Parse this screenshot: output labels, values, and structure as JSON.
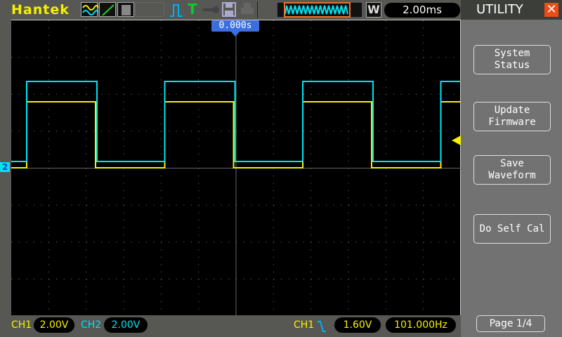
{
  "header": {
    "brand": "Hantek",
    "timebase_label": "W",
    "timebase": "2.00ms",
    "trigger_time": "0.000s"
  },
  "menu": {
    "title": "UTILITY",
    "items": [
      [
        "System",
        "Status"
      ],
      [
        "Update",
        "Firmware"
      ],
      [
        "Save",
        "Waveform"
      ],
      [
        "Do Self Cal"
      ]
    ],
    "page": "Page 1/4"
  },
  "status": {
    "ch1_label": "CH1",
    "ch1_scale": "2.00V",
    "ch2_label": "CH2",
    "ch2_scale": "2.00V",
    "trig_source": "CH1",
    "trig_level": "1.60V",
    "frequency": "101.000Hz"
  },
  "channel_marker": "2",
  "colors": {
    "ch1": "#f6f000",
    "ch2": "#00e4f0",
    "accent": "#3b6fe0",
    "close": "#f04a16"
  },
  "icons": [
    "dual-wave-icon",
    "line-icon",
    "persist-icon",
    "pulse-trigger-icon",
    "trig-T-icon",
    "key-icon",
    "save-disk-icon",
    "printer-icon"
  ]
}
